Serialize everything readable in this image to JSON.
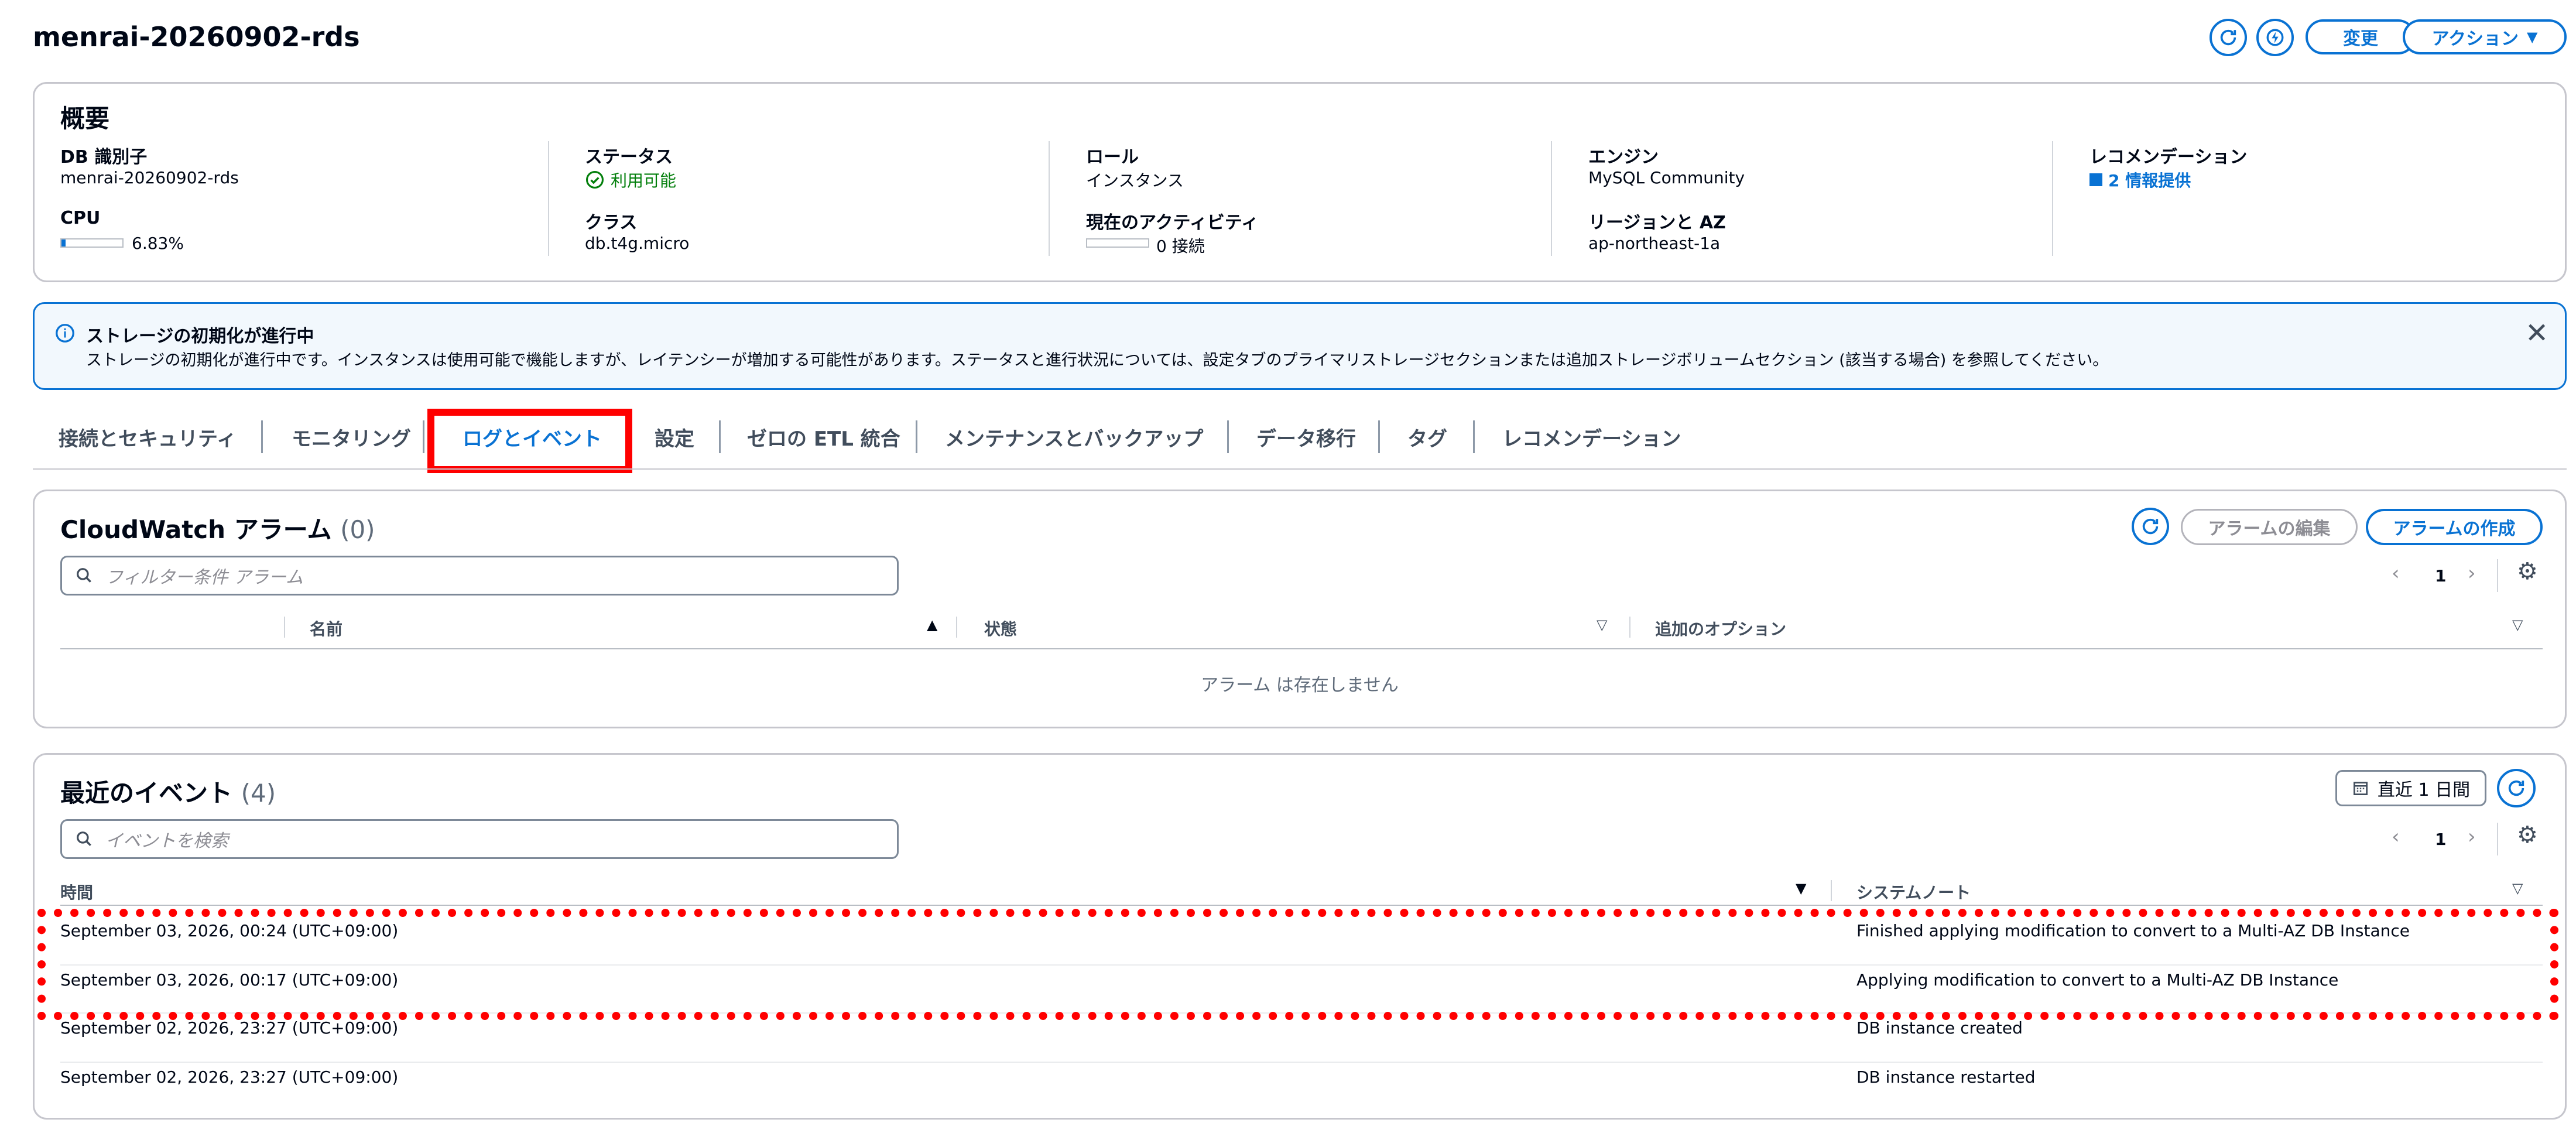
{
  "page": {
    "title": "menrai-20260902-rds",
    "buttons": {
      "modify": "変更",
      "actions": "アクション"
    }
  },
  "summary": {
    "heading": "概要",
    "db_id_label": "DB 識別子",
    "db_id_value": "menrai-20260902-rds",
    "cpu_label": "CPU",
    "cpu_value": "6.83%",
    "cpu_percent": 6.83,
    "status_label": "ステータス",
    "status_value": "利用可能",
    "class_label": "クラス",
    "class_value": "db.t4g.micro",
    "role_label": "ロール",
    "role_value": "インスタンス",
    "activity_label": "現在のアクティビティ",
    "activity_value": "0 接続",
    "engine_label": "エンジン",
    "engine_value": "MySQL Community",
    "region_label": "リージョンと AZ",
    "region_value": "ap-northeast-1a",
    "recommend_label": "レコメンデーション",
    "recommend_value": "2 情報提供"
  },
  "banner": {
    "title": "ストレージの初期化が進行中",
    "body": "ストレージの初期化が進行中です。インスタンスは使用可能で機能しますが、レイテンシーが増加する可能性があります。ステータスと進行状況については、設定タブのプライマリストレージセクションまたは追加ストレージボリュームセクション (該当する場合) を参照してください。"
  },
  "tabs": [
    {
      "label": "接続とセキュリティ"
    },
    {
      "label": "モニタリング"
    },
    {
      "label": "ログとイベント",
      "active": true
    },
    {
      "label": "設定"
    },
    {
      "label": "ゼロの ETL 統合"
    },
    {
      "label": "メンテナンスとバックアップ"
    },
    {
      "label": "データ移行"
    },
    {
      "label": "タグ"
    },
    {
      "label": "レコメンデーション"
    }
  ],
  "alarms": {
    "title": "CloudWatch アラーム",
    "count": "(0)",
    "edit_button": "アラームの編集",
    "create_button": "アラームの作成",
    "search_placeholder": "フィルター条件 アラーム",
    "page": "1",
    "columns": [
      "名前",
      "状態",
      "追加のオプション"
    ],
    "empty_text": "アラーム は存在しません"
  },
  "events": {
    "title": "最近のイベント",
    "count": "(4)",
    "range_button": "直近 1 日間",
    "search_placeholder": "イベントを検索",
    "page": "1",
    "columns": [
      "時間",
      "システムノート"
    ],
    "rows": [
      {
        "time": "September 03, 2026, 00:24 (UTC+09:00)",
        "note": "Finished applying modification to convert to a Multi-AZ DB Instance"
      },
      {
        "time": "September 03, 2026, 00:17 (UTC+09:00)",
        "note": "Applying modification to convert to a Multi-AZ DB Instance"
      },
      {
        "time": "September 02, 2026, 23:27 (UTC+09:00)",
        "note": "DB instance created"
      },
      {
        "time": "September 02, 2026, 23:27 (UTC+09:00)",
        "note": "DB instance restarted"
      }
    ]
  },
  "colors": {
    "accent": "#0972d3",
    "success": "#037f0c",
    "highlight_red": "#ff0000",
    "info_bg": "#f2f8fd"
  }
}
